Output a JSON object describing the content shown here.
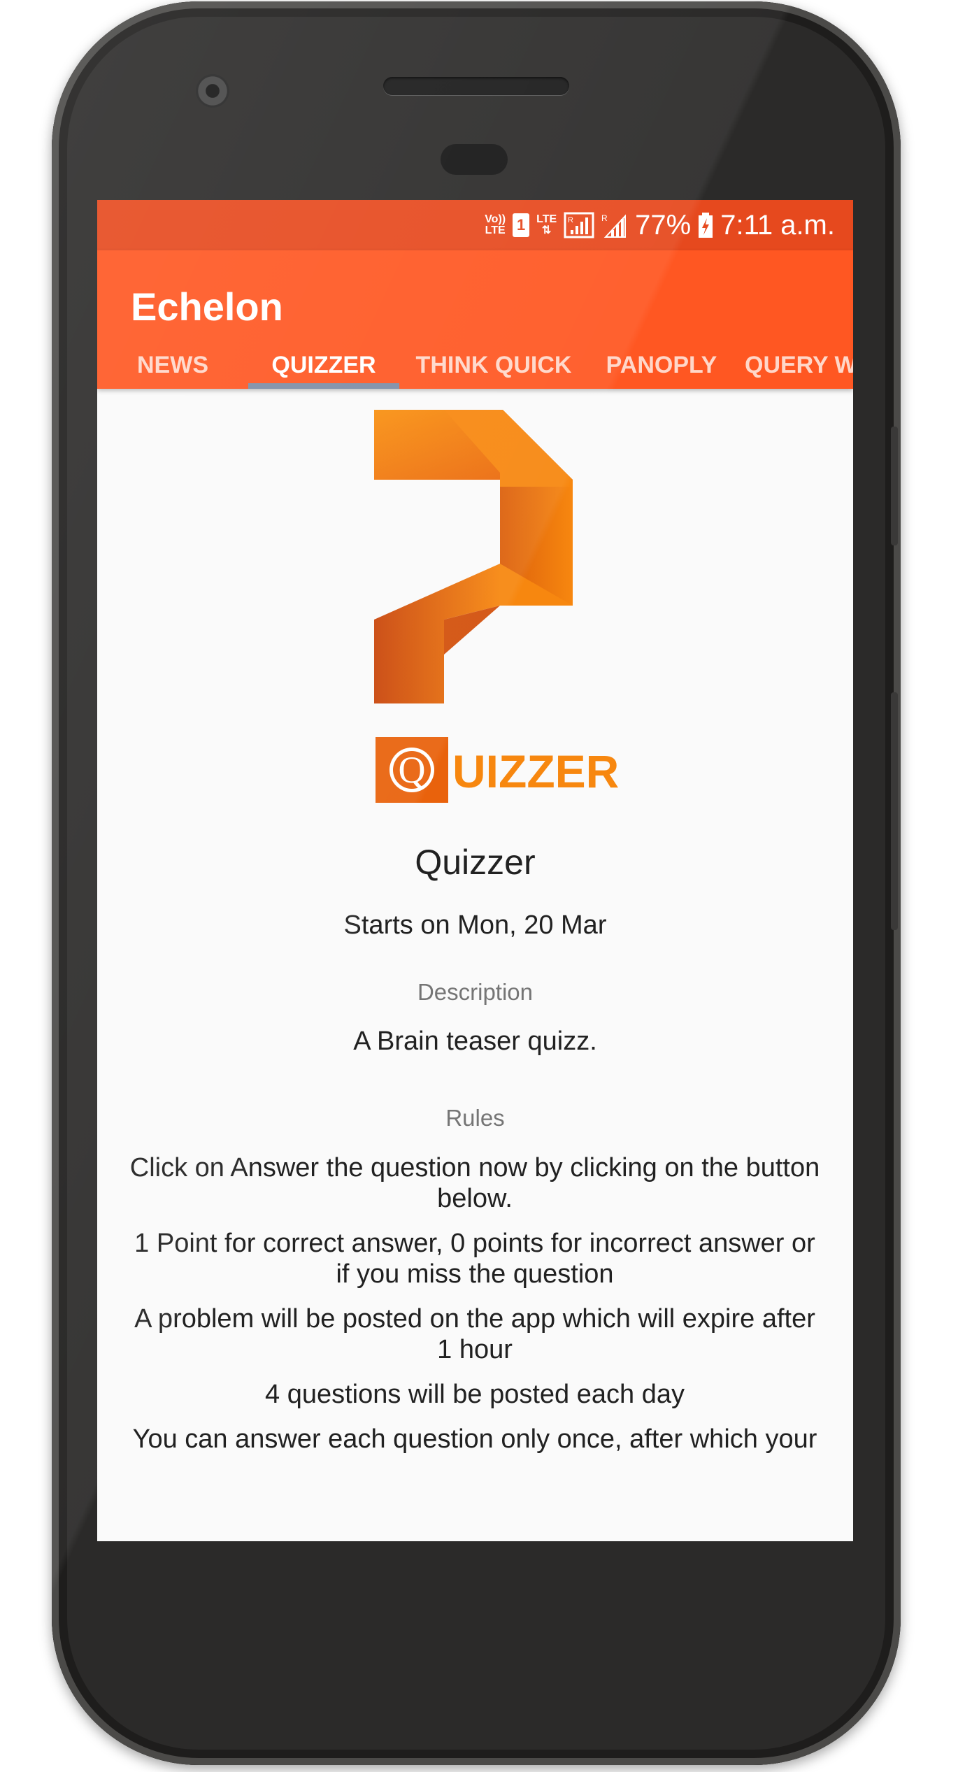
{
  "status_bar": {
    "volte_top": "Vo))",
    "volte_bottom": "LTE",
    "sim": "1",
    "lte": "LTE",
    "roaming_1": "R",
    "roaming_2": "R",
    "battery": "77%",
    "time": "7:11 a.m."
  },
  "app": {
    "title": "Echelon"
  },
  "tabs": [
    {
      "label": "NEWS",
      "active": false
    },
    {
      "label": "QUIZZER",
      "active": true
    },
    {
      "label": "THINK QUICK",
      "active": false
    },
    {
      "label": "PANOPLY",
      "active": false
    },
    {
      "label": "QUERY WIZ",
      "active": false
    }
  ],
  "event": {
    "logo_letter": "Q",
    "logo_word": "UIZZER",
    "title": "Quizzer",
    "starts": "Starts on Mon, 20 Mar",
    "description_label": "Description",
    "description": "A Brain teaser quizz.",
    "rules_label": "Rules",
    "rules": [
      "Click on Answer the question now by clicking on the button below.",
      "1 Point for correct answer, 0 points for incorrect answer or if you miss the question",
      "A problem will be posted on the app which will expire after 1 hour",
      "4 questions will be posted each day",
      "You can answer each question only once, after which your"
    ]
  },
  "colors": {
    "status_bar": "#e6491e",
    "app_bar": "#ff5722",
    "tab_indicator": "#7d8da6",
    "logo_orange": "#f7870f"
  }
}
